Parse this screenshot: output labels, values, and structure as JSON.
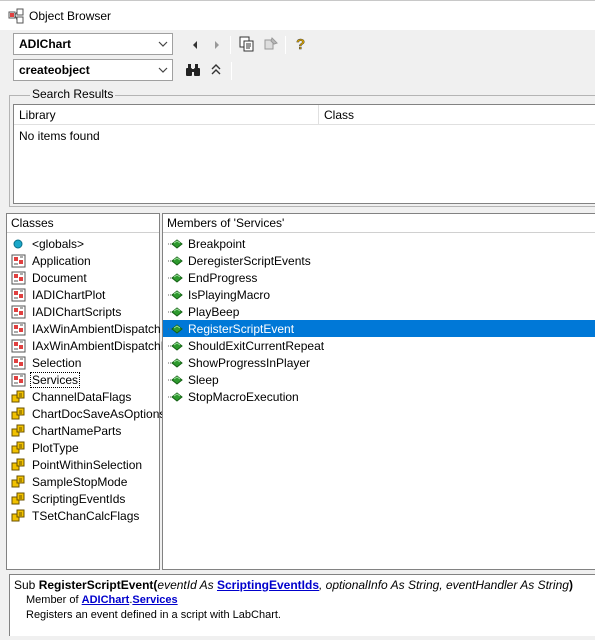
{
  "window": {
    "title": "Object Browser"
  },
  "toolbar": {
    "library_combo": "ADIChart",
    "search_combo": "createobject",
    "back_label": "Go Back",
    "forward_label": "Go Forward"
  },
  "search_results": {
    "legend": "Search Results",
    "columns": [
      "Library",
      "Class"
    ],
    "empty_text": "No items found"
  },
  "classes": {
    "header": "Classes",
    "items": [
      {
        "label": "<globals>",
        "icon": "globals-icon"
      },
      {
        "label": "Application",
        "icon": "class-icon"
      },
      {
        "label": "Document",
        "icon": "class-icon"
      },
      {
        "label": "IADIChartPlot",
        "icon": "class-icon"
      },
      {
        "label": "IADIChartScripts",
        "icon": "class-icon"
      },
      {
        "label": "IAxWinAmbientDispatch",
        "icon": "class-icon"
      },
      {
        "label": "IAxWinAmbientDispatchEx",
        "icon": "class-icon"
      },
      {
        "label": "Selection",
        "icon": "class-icon"
      },
      {
        "label": "Services",
        "icon": "class-icon"
      },
      {
        "label": "ChannelDataFlags",
        "icon": "enum-icon"
      },
      {
        "label": "ChartDocSaveAsOptions",
        "icon": "enum-icon"
      },
      {
        "label": "ChartNameParts",
        "icon": "enum-icon"
      },
      {
        "label": "PlotType",
        "icon": "enum-icon"
      },
      {
        "label": "PointWithinSelection",
        "icon": "enum-icon"
      },
      {
        "label": "SampleStopMode",
        "icon": "enum-icon"
      },
      {
        "label": "ScriptingEventIds",
        "icon": "enum-icon"
      },
      {
        "label": "TSetChanCalcFlags",
        "icon": "enum-icon"
      }
    ],
    "focused_index": 8
  },
  "members": {
    "header": "Members of 'Services'",
    "items": [
      {
        "label": "Breakpoint"
      },
      {
        "label": "DeregisterScriptEvents"
      },
      {
        "label": "EndProgress"
      },
      {
        "label": "IsPlayingMacro"
      },
      {
        "label": "PlayBeep"
      },
      {
        "label": "RegisterScriptEvent"
      },
      {
        "label": "ShouldExitCurrentRepeat"
      },
      {
        "label": "ShowProgressInPlayer"
      },
      {
        "label": "Sleep"
      },
      {
        "label": "StopMacroExecution"
      }
    ],
    "selected_index": 5
  },
  "detail": {
    "prefix": "Sub ",
    "name": "RegisterScriptEvent",
    "open": "(",
    "param1": "eventId As ",
    "param1_type": "ScriptingEventIds",
    "rest": ", optionalInfo As String, eventHandler As String",
    "close": ")",
    "member_of": "Member of ",
    "lib_link": "ADIChart",
    "dot": ".",
    "class_link": "Services",
    "description": "Registers an event defined in a script with LabChart."
  },
  "colors": {
    "selection": "#0078d7",
    "link": "#0000cc",
    "method_icon": "#2e9a2e"
  }
}
